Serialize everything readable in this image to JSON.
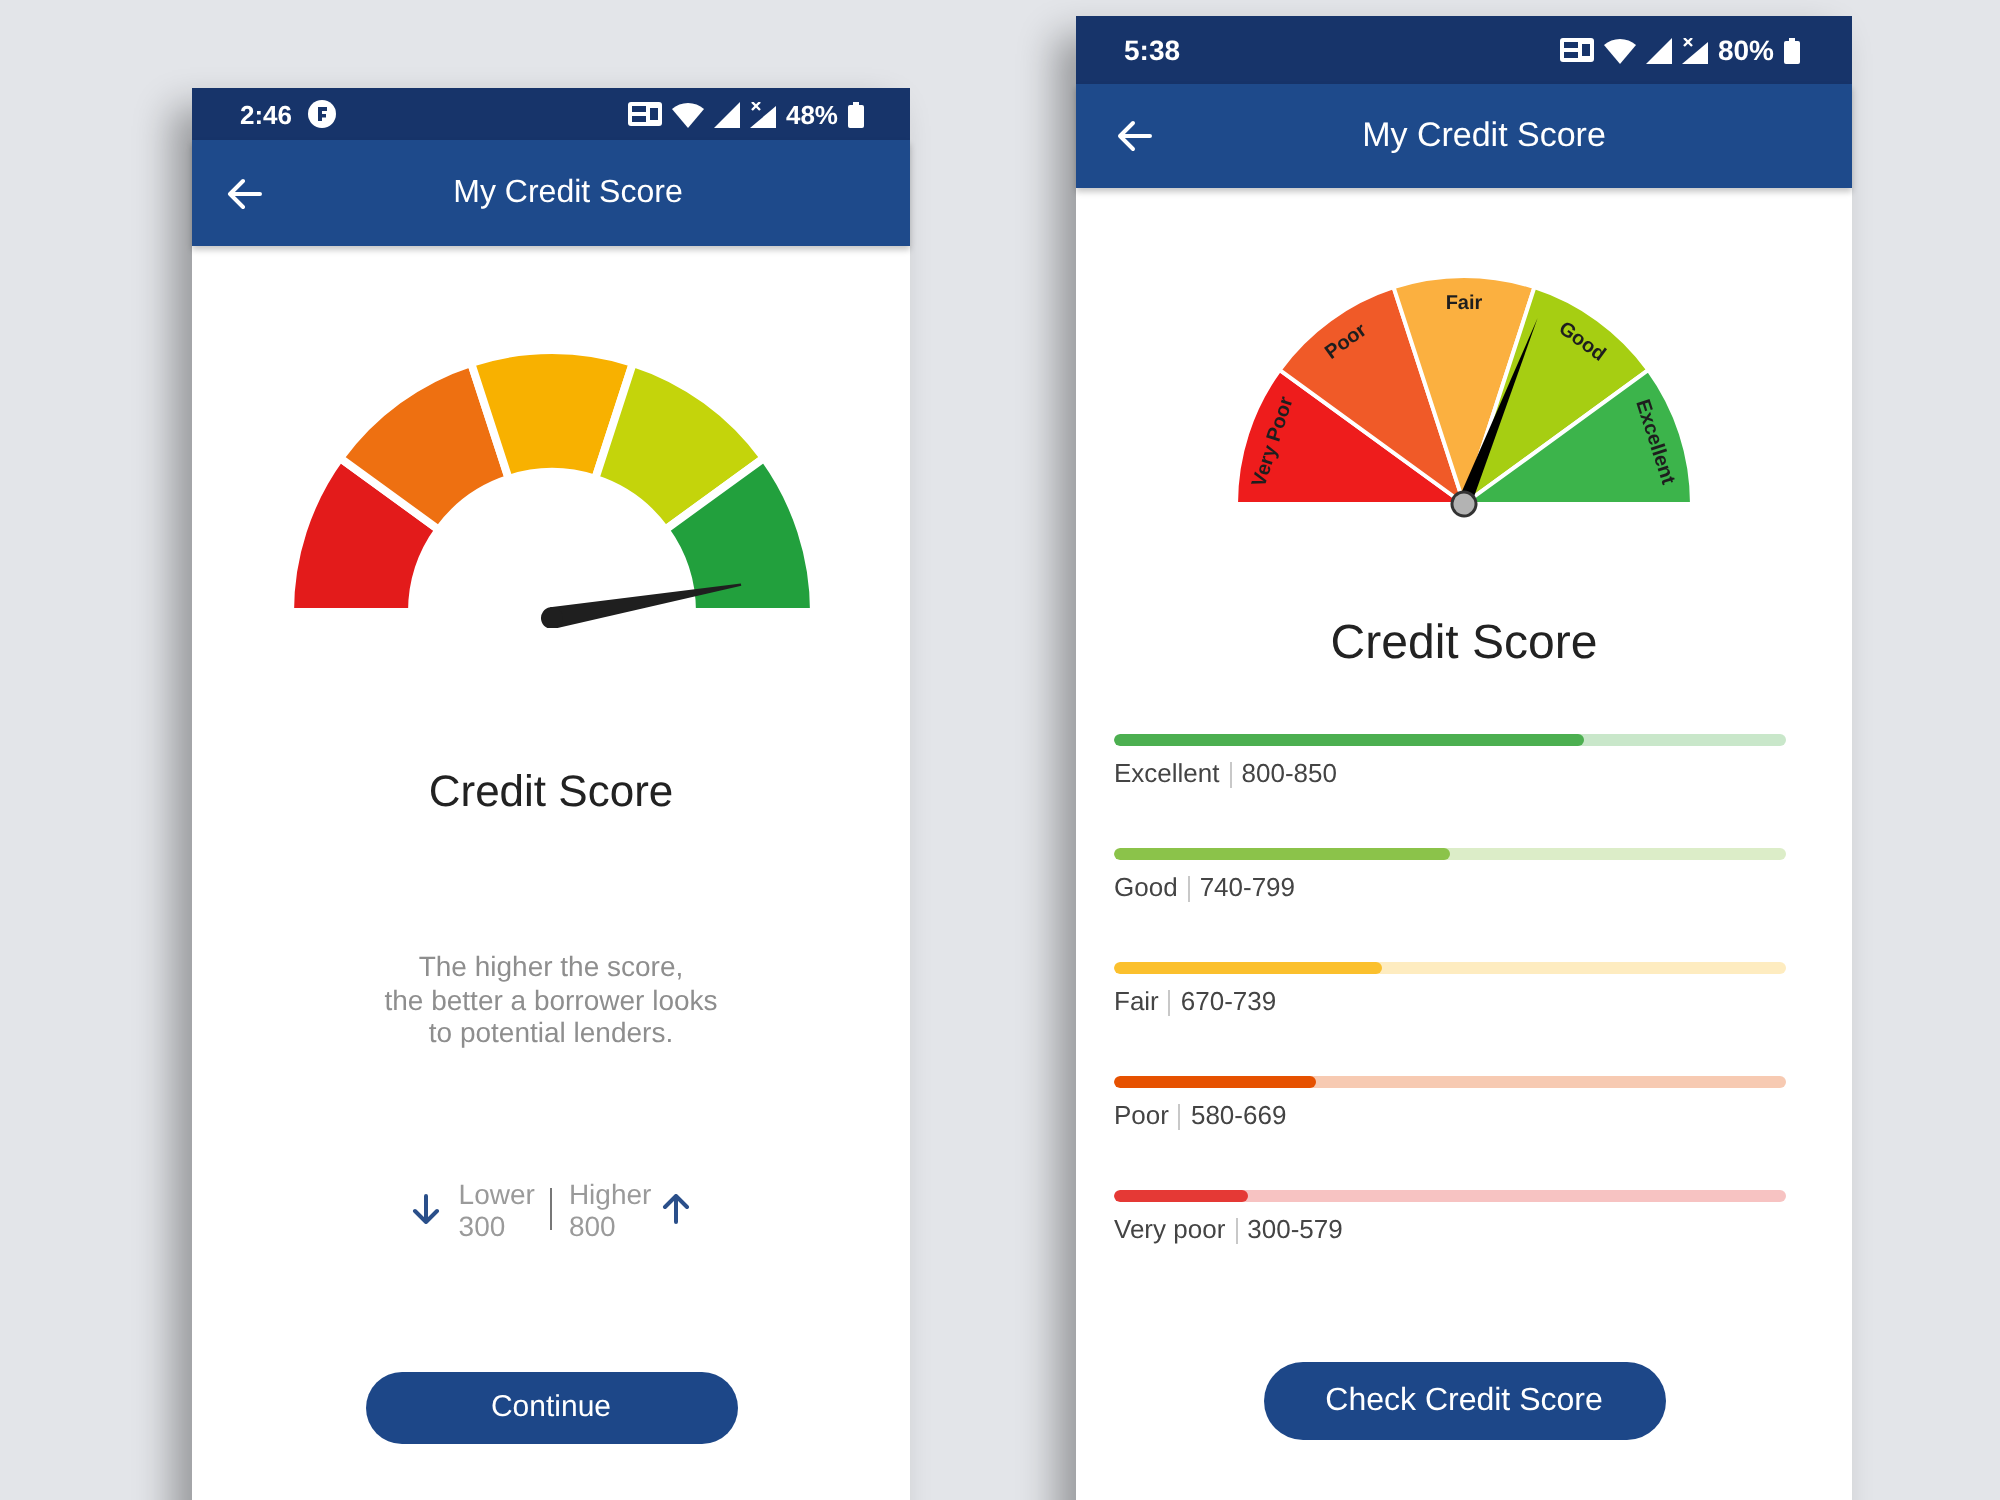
{
  "screens": [
    {
      "kind": "intro",
      "status_bar": {
        "time": "2:46",
        "notification_icon": true,
        "battery": "48%"
      },
      "header": {
        "title": "My Credit Score"
      },
      "heading": "Credit Score",
      "description": "The higher the score,\nthe better a borrower looks\nto potential lenders.",
      "scale": {
        "lower": {
          "label": "Lower",
          "value": "300"
        },
        "higher": {
          "label": "Higher",
          "value": "800"
        }
      },
      "button": "Continue"
    },
    {
      "kind": "ranges",
      "status_bar": {
        "time": "5:38",
        "notification_icon": false,
        "battery": "80%"
      },
      "header": {
        "title": "My Credit Score"
      },
      "gauge": {
        "level": 0.62,
        "segments": [
          {
            "label": "Very Poor",
            "color": "#ee1c1c"
          },
          {
            "label": "Poor",
            "color": "#f05a28"
          },
          {
            "label": "Fair",
            "color": "#fbb040"
          },
          {
            "label": "Good",
            "color": "#a6ce12"
          },
          {
            "label": "Excellent",
            "color": "#3cb44b"
          }
        ]
      },
      "heading": "Credit Score",
      "ranges": [
        {
          "name": "Excellent",
          "range": "800-850",
          "level": 0.7,
          "color": "#4caf50"
        },
        {
          "name": "Good",
          "range": "740-799",
          "level": 0.5,
          "color": "#8bc34a"
        },
        {
          "name": "Fair",
          "range": "670-739",
          "level": 0.4,
          "color": "#fbc02d"
        },
        {
          "name": "Poor",
          "range": "580-669",
          "level": 0.3,
          "color": "#e65100"
        },
        {
          "name": "Very poor",
          "range": "300-579",
          "level": 0.2,
          "color": "#e53935"
        }
      ],
      "button": "Check Credit Score"
    }
  ]
}
